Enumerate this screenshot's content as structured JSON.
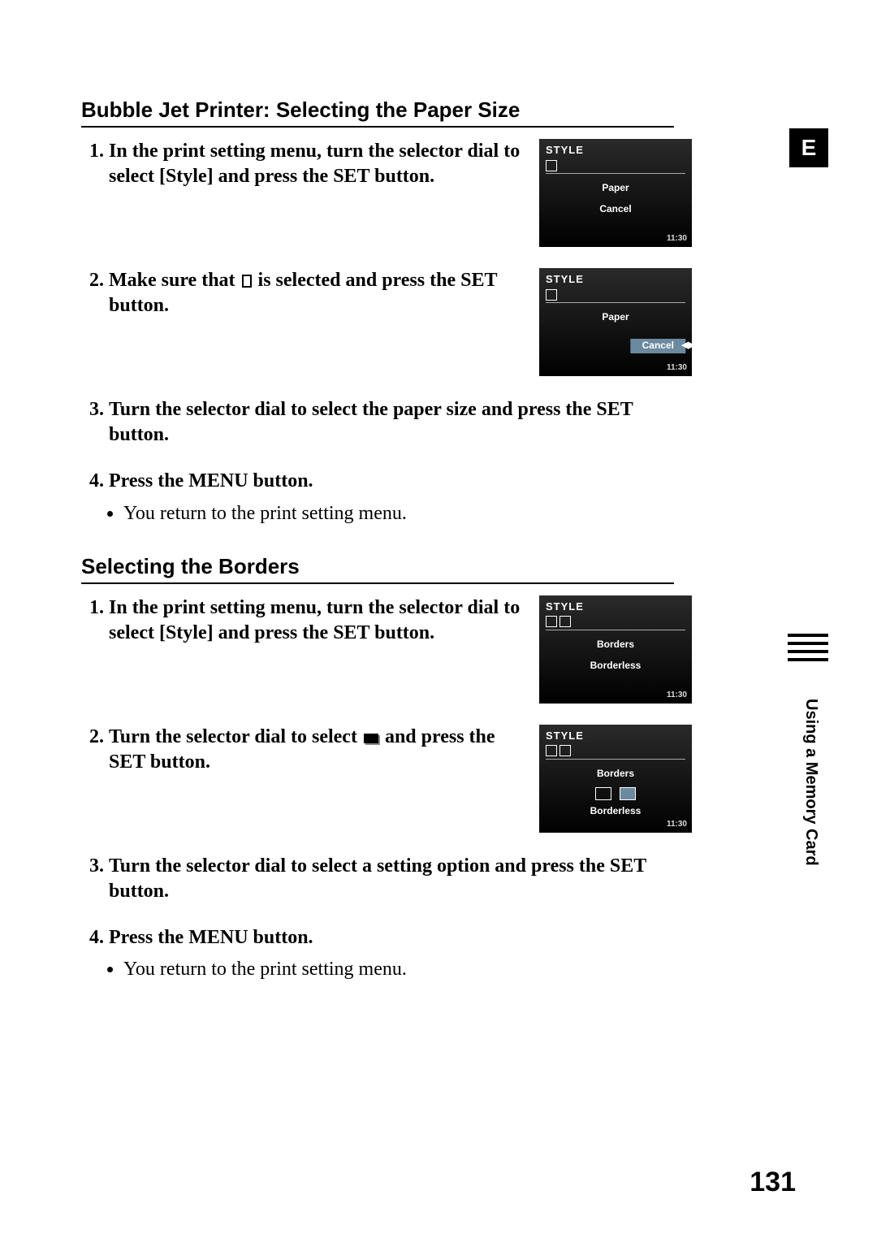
{
  "tab_e": "E",
  "side_label": "Using a Memory Card",
  "page_number": "131",
  "sections": [
    {
      "heading": "Bubble Jet Printer: Selecting the Paper Size",
      "steps": [
        {
          "text": "In the print setting menu, turn the selector dial to select [Style] and press the SET button.",
          "lcd": {
            "title": "STYLE",
            "line1": "Paper",
            "line2": "Cancel",
            "footer": "11:30",
            "sel": null
          }
        },
        {
          "text_a": "Make sure that ",
          "text_b": " is selected and press the SET button.",
          "icon": "portrait",
          "lcd": {
            "title": "STYLE",
            "line1": "Paper",
            "line2": "Cancel",
            "footer": "11:30",
            "sel": "line2"
          }
        },
        {
          "text": "Turn the selector dial to select the paper size and press the SET button."
        },
        {
          "text": "Press the MENU button.",
          "sub": [
            "You return to the print setting menu."
          ]
        }
      ]
    },
    {
      "heading": "Selecting the Borders",
      "steps": [
        {
          "text": "In the print setting menu, turn the selector dial to select [Style] and press the SET button.",
          "lcd": {
            "title": "STYLE",
            "line1": "Borders",
            "line2": "Borderless",
            "footer": "11:30",
            "sel": null
          }
        },
        {
          "text_a": "Turn the selector dial to select ",
          "text_b": " and press the SET button.",
          "icon": "landscape",
          "lcd": {
            "title": "STYLE",
            "line1": "Borders",
            "line2": "Borderless",
            "footer": "11:30",
            "chips": true
          }
        },
        {
          "text": "Turn the selector dial to select a setting option and press the SET button."
        },
        {
          "text": "Press the MENU button.",
          "sub": [
            "You return to the print setting menu."
          ]
        }
      ]
    }
  ]
}
